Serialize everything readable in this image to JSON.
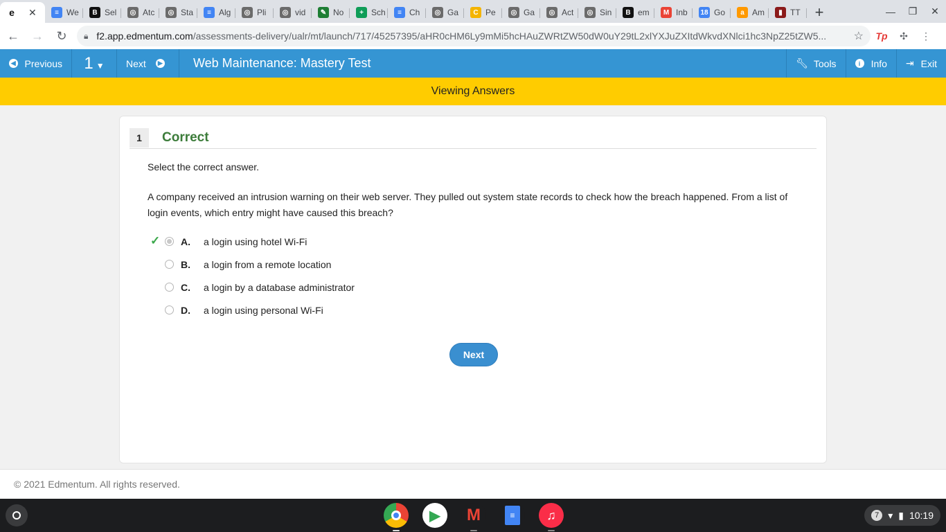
{
  "browser": {
    "tabs": [
      {
        "title": "",
        "favicon": "edmentum-icon",
        "color": "#ffffff",
        "glyph": "e",
        "active": true
      },
      {
        "title": "We",
        "favicon": "docs-icon",
        "color": "#4285f4",
        "glyph": "≡"
      },
      {
        "title": "Sel",
        "favicon": "brainly-icon",
        "color": "#111111",
        "glyph": "B"
      },
      {
        "title": "Atc",
        "favicon": "globe-icon",
        "color": "#6b6b6b",
        "glyph": "◎"
      },
      {
        "title": "Sta",
        "favicon": "globe-icon",
        "color": "#6b6b6b",
        "glyph": "◎"
      },
      {
        "title": "Alg",
        "favicon": "docs-icon",
        "color": "#4285f4",
        "glyph": "≡"
      },
      {
        "title": "Pli",
        "favicon": "globe-icon",
        "color": "#6b6b6b",
        "glyph": "◎"
      },
      {
        "title": "vid",
        "favicon": "globe-icon",
        "color": "#6b6b6b",
        "glyph": "◎"
      },
      {
        "title": "No",
        "favicon": "notes-icon",
        "color": "#1e7e34",
        "glyph": "✎"
      },
      {
        "title": "Sch",
        "favicon": "sheets-icon",
        "color": "#0f9d58",
        "glyph": "+"
      },
      {
        "title": "Ch",
        "favicon": "docs-icon",
        "color": "#4285f4",
        "glyph": "≡"
      },
      {
        "title": "Ga",
        "favicon": "globe-icon",
        "color": "#6b6b6b",
        "glyph": "◎"
      },
      {
        "title": "Pe",
        "favicon": "canva-icon",
        "color": "#f4b400",
        "glyph": "C"
      },
      {
        "title": "Ga",
        "favicon": "globe-icon",
        "color": "#6b6b6b",
        "glyph": "◎"
      },
      {
        "title": "Act",
        "favicon": "globe-icon",
        "color": "#6b6b6b",
        "glyph": "◎"
      },
      {
        "title": "Sin",
        "favicon": "globe-icon",
        "color": "#6b6b6b",
        "glyph": "◎"
      },
      {
        "title": "em",
        "favicon": "brainly-icon",
        "color": "#111111",
        "glyph": "B"
      },
      {
        "title": "Inb",
        "favicon": "gmail-icon",
        "color": "#ea4335",
        "glyph": "M"
      },
      {
        "title": "Go",
        "favicon": "calendar-icon",
        "color": "#4285f4",
        "glyph": "18"
      },
      {
        "title": "Am",
        "favicon": "amazon-icon",
        "color": "#ff9900",
        "glyph": "a"
      },
      {
        "title": "TT",
        "favicon": "tt-icon",
        "color": "#8b1a1a",
        "glyph": "▮"
      }
    ],
    "url_host": "f2.app.edmentum.com",
    "url_path": "/assessments-delivery/ualr/mt/launch/717/45257395/aHR0cHM6Ly9mMi5hcHAuZWRtZW50dW0uY29tL2xlYXJuZXItdWkvdXNlci1hc3NpZ25tZW5..."
  },
  "appnav": {
    "previous": "Previous",
    "question_number": "1",
    "next": "Next",
    "title": "Web Maintenance: Mastery Test",
    "tools": "Tools",
    "info": "Info",
    "exit": "Exit"
  },
  "banner": "Viewing Answers",
  "question": {
    "number": "1",
    "status": "Correct",
    "instruction": "Select the correct answer.",
    "text": "A company received an intrusion warning on their web server. They pulled out system state records to check how the breach happened. From a list of login events, which entry might have caused this breach?",
    "options": [
      {
        "letter": "A.",
        "text": "a login using hotel Wi-Fi",
        "selected": true,
        "correct": true
      },
      {
        "letter": "B.",
        "text": "a login from a remote location",
        "selected": false,
        "correct": false
      },
      {
        "letter": "C.",
        "text": "a login by a database administrator",
        "selected": false,
        "correct": false
      },
      {
        "letter": "D.",
        "text": "a login using personal Wi-Fi",
        "selected": false,
        "correct": false
      }
    ],
    "next_button": "Next"
  },
  "footer": "© 2021 Edmentum. All rights reserved.",
  "shelf": {
    "notification_count": "7",
    "time": "10:19"
  }
}
